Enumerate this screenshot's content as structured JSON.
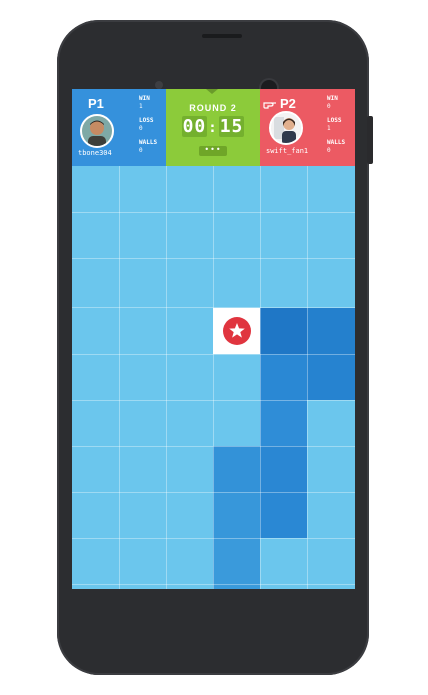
{
  "p1": {
    "tag": "P1",
    "username": "tbone304",
    "win_label": "WIN",
    "win": "1",
    "loss_label": "LOSS",
    "loss": "0",
    "walls_label": "WALLS",
    "walls": "0"
  },
  "p2": {
    "tag": "P2",
    "username": "swift_fan1",
    "win_label": "WIN",
    "win": "0",
    "loss_label": "LOSS",
    "loss": "1",
    "walls_label": "WALLS",
    "walls": "0"
  },
  "center": {
    "round": "ROUND 2",
    "timer_min": "00",
    "timer_sec": "15",
    "menu_label": "•••"
  },
  "colors": {
    "p1": "#3591dc",
    "p2": "#ec5a63",
    "center": "#8ccb3a",
    "board": "#6bc6ed",
    "wall_light": "#2b88d6",
    "wall_dark": "#1f76c4",
    "star": "#e0353f"
  },
  "icons": {
    "star": "star-icon",
    "p2_pointer": "hand-pointer-icon"
  }
}
